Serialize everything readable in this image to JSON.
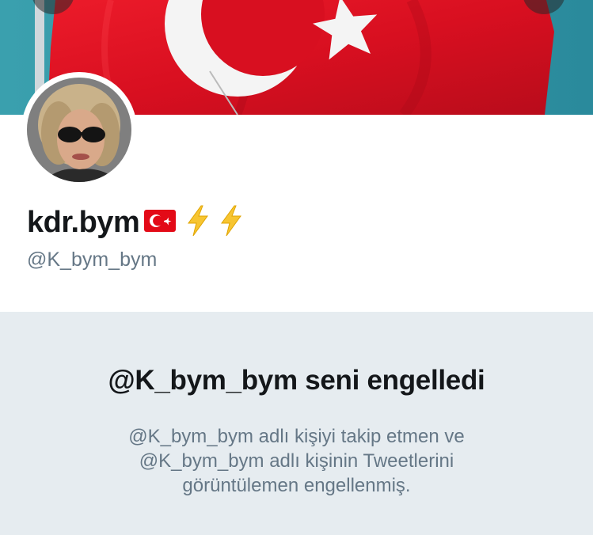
{
  "profile": {
    "display_name": "kdr.bym",
    "emoji_suffix": [
      "turkey-flag",
      "lightning-bolt",
      "lightning-bolt"
    ],
    "handle": "@K_bym_bym"
  },
  "blocked": {
    "title": "@K_bym_bym seni engelledi",
    "description": "@K_bym_bym adlı kişiyi takip etmen ve @K_bym_bym adlı kişinin Tweetlerini görüntülemen engellenmiş."
  },
  "colors": {
    "flag_red": "#e30a17",
    "text_primary": "#14171a",
    "text_secondary": "#657786",
    "panel_bg": "#e6ecf0",
    "bolt_yellow": "#f7c531"
  }
}
